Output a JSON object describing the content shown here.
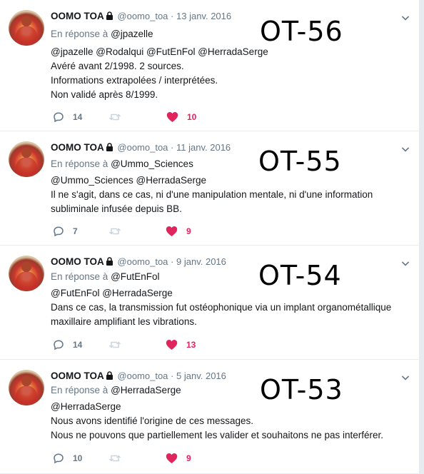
{
  "tweets": [
    {
      "name": "OOMO TOA",
      "handle": "@oomo_toa",
      "dot": "·",
      "date": "13 janv. 2016",
      "reply_prefix": "En réponse à",
      "reply_user": "@jpazelle",
      "lines": [
        "@jpazelle @Rodalqui @FutEnFol @HerradaSerge",
        "Avéré avant 2/1998. 2 sources.",
        "Informations extrapolées / interprétées.",
        "Non validé après 8/1999."
      ],
      "reply_count": "14",
      "like_count": "10",
      "overlay": "OT-56"
    },
    {
      "name": "OOMO TOA",
      "handle": "@oomo_toa",
      "dot": "·",
      "date": "11 janv. 2016",
      "reply_prefix": "En réponse à",
      "reply_user": "@Ummo_Sciences",
      "lines": [
        "@Ummo_Sciences @HerradaSerge",
        "Il ne s'agit, dans ce cas, ni d'une manipulation mentale, ni d'une information",
        "subliminale infusée depuis BB."
      ],
      "reply_count": "7",
      "like_count": "9",
      "overlay": "OT-55"
    },
    {
      "name": "OOMO TOA",
      "handle": "@oomo_toa",
      "dot": "·",
      "date": "9 janv. 2016",
      "reply_prefix": "En réponse à",
      "reply_user": "@FutEnFol",
      "lines": [
        "@FutEnFol @HerradaSerge",
        "Dans ce cas, la transmission fut ostéophonique via un implant organométallique",
        "maxillaire amplifiant les vibrations."
      ],
      "reply_count": "14",
      "like_count": "13",
      "overlay": "OT-54"
    },
    {
      "name": "OOMO TOA",
      "handle": "@oomo_toa",
      "dot": "·",
      "date": "5 janv. 2016",
      "reply_prefix": "En réponse à",
      "reply_user": "@HerradaSerge",
      "lines": [
        "@HerradaSerge",
        "Nous avons identifié l'origine de ces messages.",
        "Nous ne pouvons que partiellement les valider et souhaitons ne pas interférer."
      ],
      "reply_count": "10",
      "like_count": "9",
      "overlay": "OT-53"
    }
  ],
  "icons": {
    "lock": "lock-icon",
    "menu": "chevron-down-icon",
    "reply": "reply-icon",
    "retweet": "retweet-icon",
    "like": "heart-icon"
  },
  "colors": {
    "muted": "#657786",
    "like": "#e0245e",
    "border": "#e6ecf0"
  }
}
